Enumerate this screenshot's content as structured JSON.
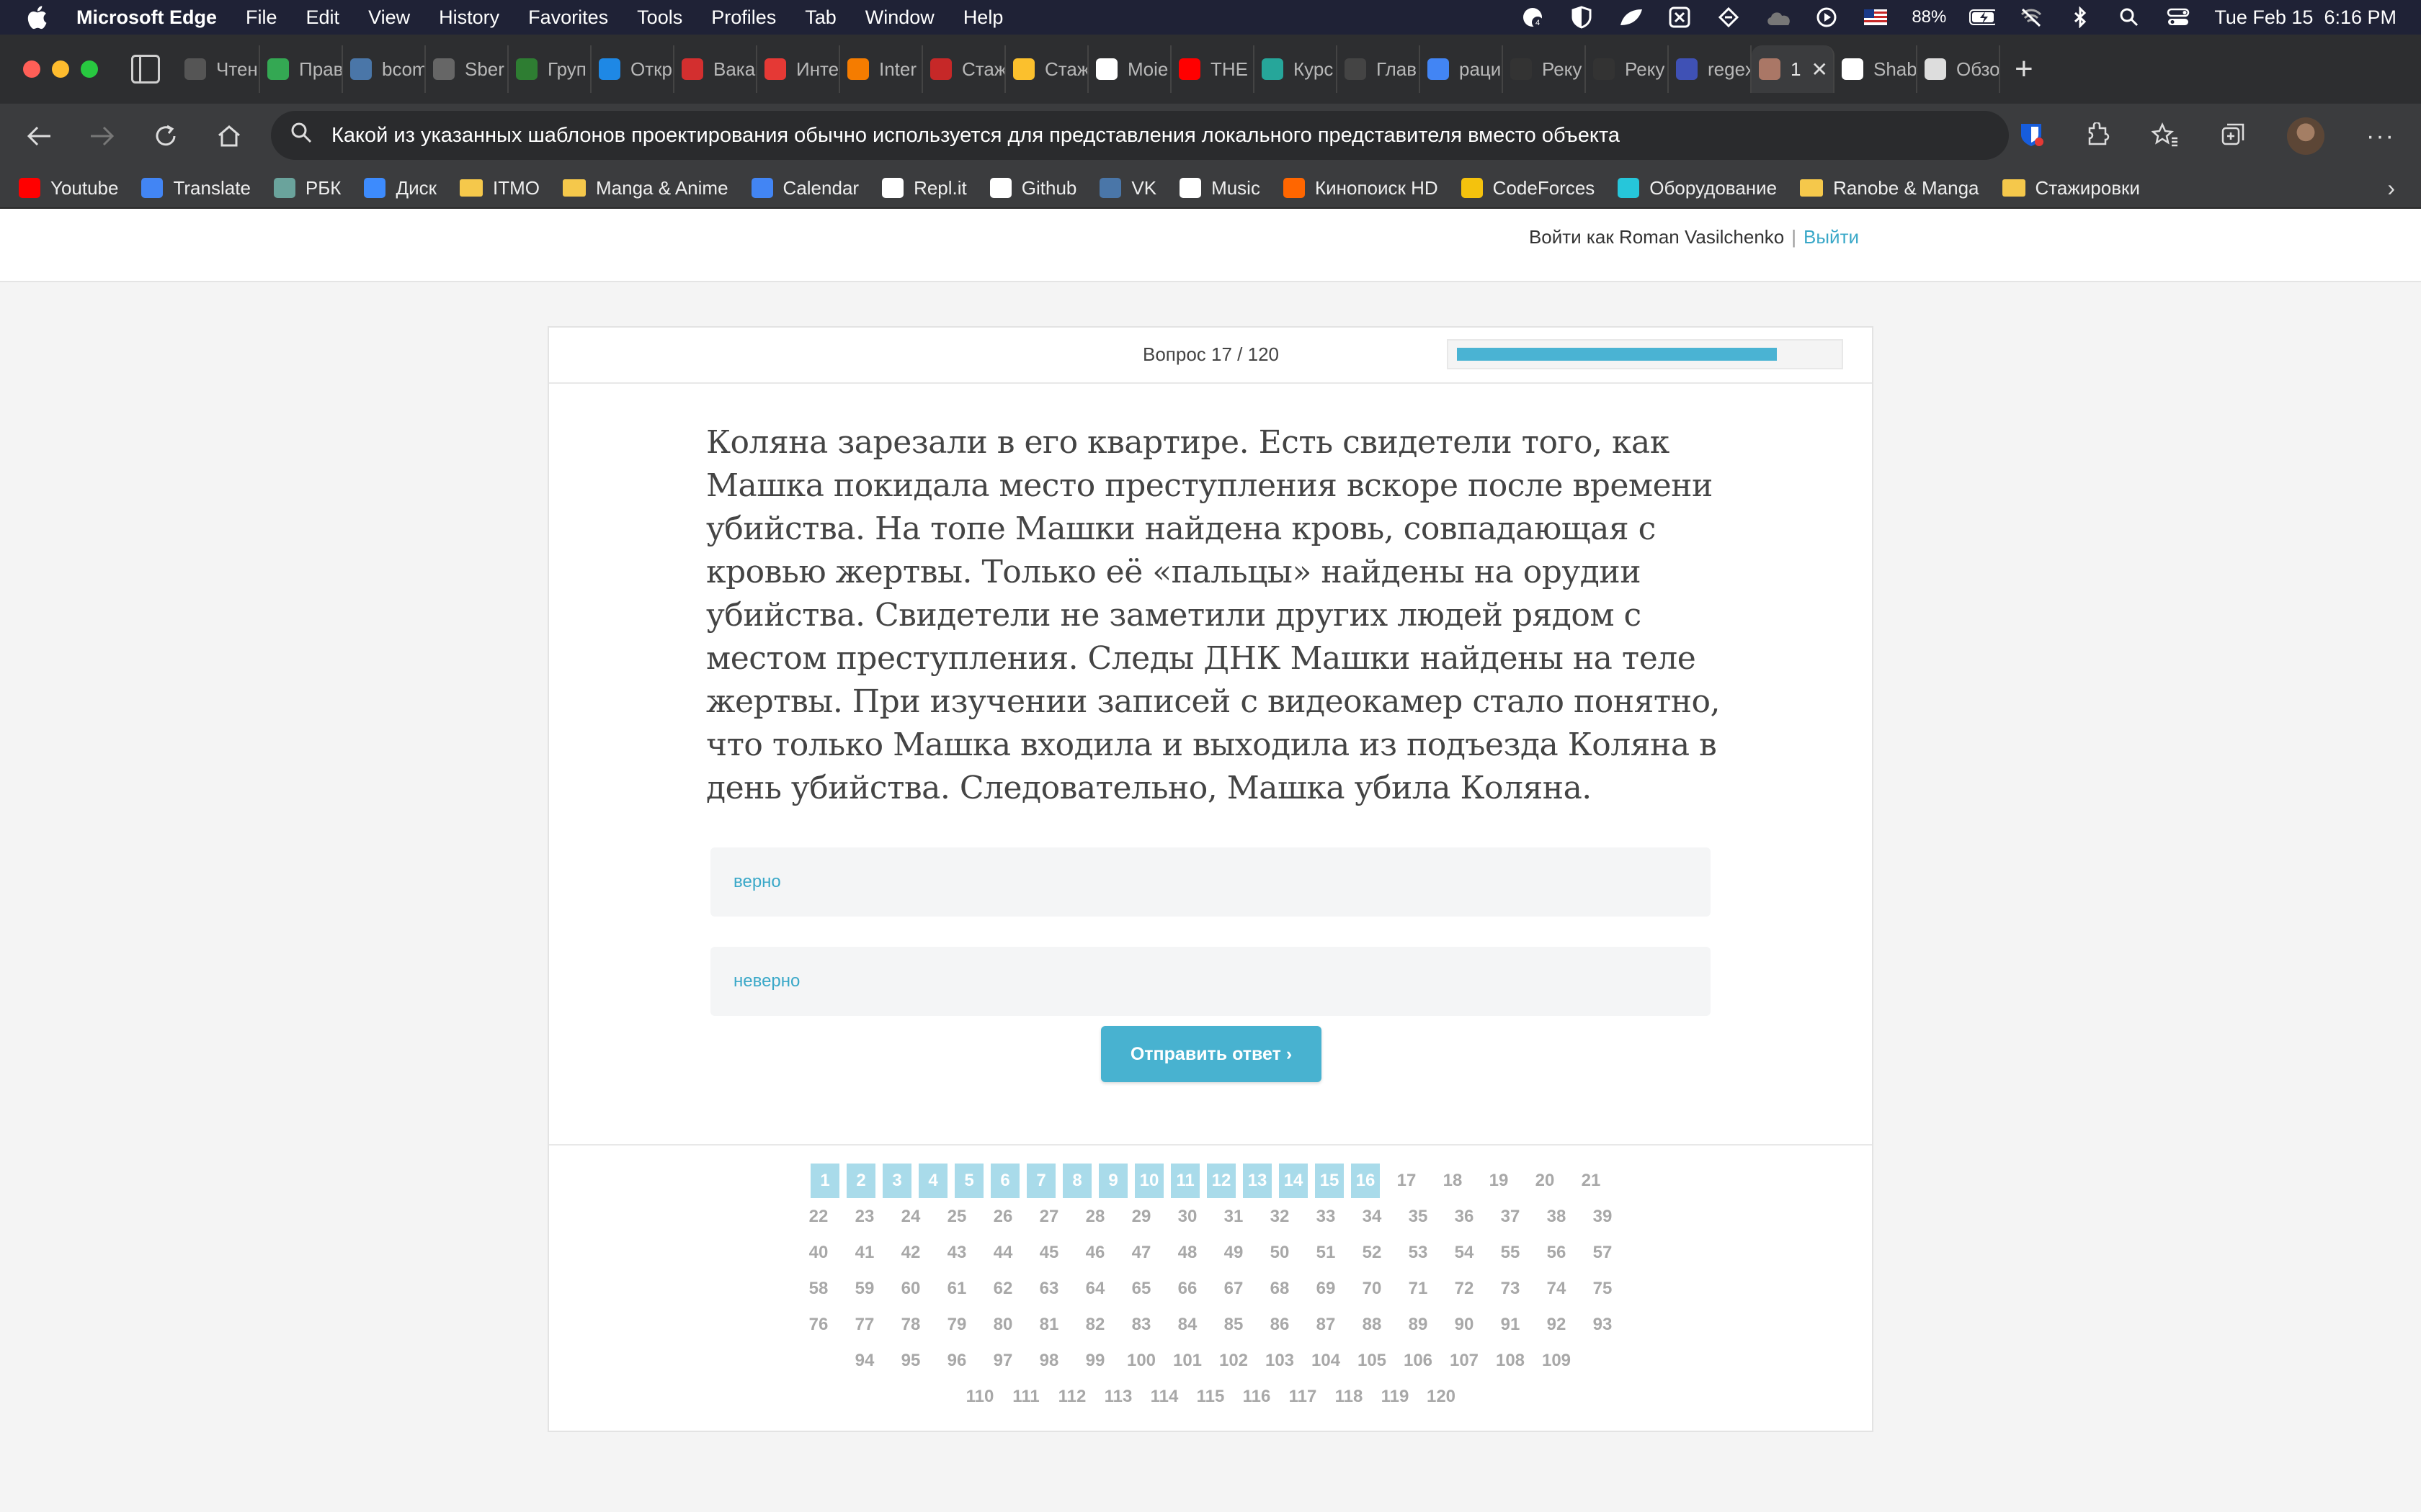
{
  "menubar": {
    "app_name": "Microsoft Edge",
    "menus": [
      "File",
      "Edit",
      "View",
      "History",
      "Favorites",
      "Tools",
      "Profiles",
      "Tab",
      "Window",
      "Help"
    ],
    "battery": "88%",
    "datetime": "Tue Feb 15  6:16 PM"
  },
  "tabs": [
    {
      "label": "Чтен",
      "color": "#555555"
    },
    {
      "label": "Прав",
      "color": "#34a853"
    },
    {
      "label": "bcom",
      "color": "#4a76a8"
    },
    {
      "label": "Sber",
      "color": "#666666"
    },
    {
      "label": "Груп",
      "color": "#2e7d32"
    },
    {
      "label": "Откр",
      "color": "#1e88e5"
    },
    {
      "label": "Вака",
      "color": "#d32f2f"
    },
    {
      "label": "Инте",
      "color": "#e53935"
    },
    {
      "label": "Inter",
      "color": "#f57c00"
    },
    {
      "label": "Стаж",
      "color": "#c62828"
    },
    {
      "label": "Стаж",
      "color": "#fbc02d"
    },
    {
      "label": "Moie",
      "color": "#ffffff"
    },
    {
      "label": "THE",
      "color": "#ff0000"
    },
    {
      "label": "Курс",
      "color": "#26a69a"
    },
    {
      "label": "Глав",
      "color": "#444444"
    },
    {
      "label": "раци",
      "color": "#4285f4"
    },
    {
      "label": "Реку",
      "color": "#333333"
    },
    {
      "label": "Реку",
      "color": "#333333"
    },
    {
      "label": "regex",
      "color": "#3f51b5"
    },
    {
      "label": "1",
      "color": "#aa7766",
      "active": true
    },
    {
      "label": "Shab",
      "color": "#ffffff"
    },
    {
      "label": "Обзо",
      "color": "#dddddd"
    }
  ],
  "address_bar": {
    "url_text": "Какой из указанных шаблонов проектирования обычно используется для представления локального представителя вместо объекта"
  },
  "bookmarks": [
    {
      "label": "Youtube",
      "icon": "youtube-icon",
      "color": "#ff0000"
    },
    {
      "label": "Translate",
      "icon": "translate-icon",
      "color": "#4285f4"
    },
    {
      "label": "РБК",
      "icon": "rbk-icon",
      "color": "#6aa39c"
    },
    {
      "label": "Диск",
      "icon": "disk-icon",
      "color": "#3d8bfd"
    },
    {
      "label": "ITMO",
      "icon": "folder-icon",
      "folder": true
    },
    {
      "label": "Manga & Anime",
      "icon": "folder-icon",
      "folder": true
    },
    {
      "label": "Calendar",
      "icon": "calendar-icon",
      "color": "#4285f4"
    },
    {
      "label": "Repl.it",
      "icon": "replit-icon",
      "color": "#ffffff"
    },
    {
      "label": "Github",
      "icon": "github-icon",
      "color": "#ffffff"
    },
    {
      "label": "VK",
      "icon": "vk-icon",
      "color": "#4a76a8"
    },
    {
      "label": "Music",
      "icon": "music-icon",
      "color": "#ffffff"
    },
    {
      "label": "Кинопоиск HD",
      "icon": "kinopoisk-icon",
      "color": "#ff6600"
    },
    {
      "label": "CodeForces",
      "icon": "codeforces-icon",
      "color": "#f4c20d"
    },
    {
      "label": "Оборудование",
      "icon": "equipment-icon",
      "color": "#26c6da"
    },
    {
      "label": "Ranobe & Manga",
      "icon": "folder-icon",
      "folder": true
    },
    {
      "label": "Стажировки",
      "icon": "folder-icon",
      "folder": true
    }
  ],
  "site": {
    "login_prefix": "Войти как Roman Vasilchenko",
    "separator": "|",
    "logout": "Выйти"
  },
  "quiz": {
    "counter": "Вопрос 17 / 120",
    "progress_fraction": 0.85,
    "question": "Коляна зарезали в его квартире. Есть свидетели того, как Машка покидала место преступления вскоре после времени убийства. На топе Машки найдена кровь, совпадающая с кровью жертвы. Только её «пальцы» найдены на орудии убийства. Свидетели не заметили других людей рядом с местом преступления. Следы ДНК Машки найдены на теле жертвы. При изучении записей с видеокамер стало понятно, что только Машка входила и выходила из подъезда Коляна в день убийства. Следовательно, Машка убила Коляна.",
    "answers": [
      "верно",
      "неверно"
    ],
    "submit_label": "Отправить ответ ›",
    "total_questions": 120,
    "answered_up_to": 16
  },
  "colors": {
    "accent": "#48b2d0",
    "answered_page": "#a9dbea",
    "link": "#3aa8c8"
  }
}
